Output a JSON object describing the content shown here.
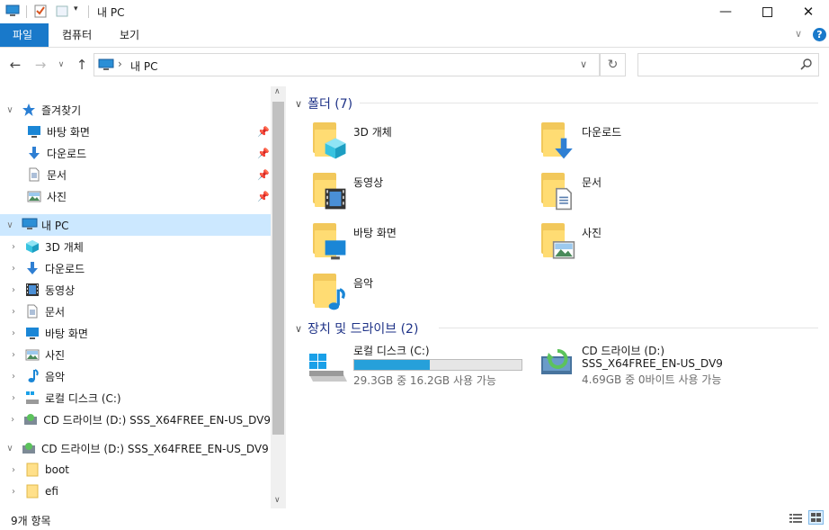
{
  "window": {
    "title": "내 PC"
  },
  "ribbon": {
    "tabs": [
      "파일",
      "컴퓨터",
      "보기"
    ]
  },
  "address": {
    "path": "내 PC",
    "separator": "›",
    "search_placeholder": ""
  },
  "nav": {
    "quick_access": {
      "label": "즐겨찾기",
      "items": [
        {
          "label": "바탕 화면",
          "icon": "desktop-icon"
        },
        {
          "label": "다운로드",
          "icon": "download-icon"
        },
        {
          "label": "문서",
          "icon": "documents-icon"
        },
        {
          "label": "사진",
          "icon": "pictures-icon"
        }
      ]
    },
    "this_pc": {
      "label": "내 PC",
      "items": [
        {
          "label": "3D 개체",
          "icon": "3d-objects-icon"
        },
        {
          "label": "다운로드",
          "icon": "download-icon"
        },
        {
          "label": "동영상",
          "icon": "videos-icon"
        },
        {
          "label": "문서",
          "icon": "documents-icon"
        },
        {
          "label": "바탕 화면",
          "icon": "desktop-icon"
        },
        {
          "label": "사진",
          "icon": "pictures-icon"
        },
        {
          "label": "음악",
          "icon": "music-icon"
        },
        {
          "label": "로컬 디스크 (C:)",
          "icon": "local-disk-icon"
        },
        {
          "label": "CD 드라이브 (D:) SSS_X64FREE_EN-US_DV9",
          "icon": "cd-drive-icon"
        }
      ]
    },
    "cd_drive": {
      "label": "CD 드라이브 (D:) SSS_X64FREE_EN-US_DV9",
      "items": [
        {
          "label": "boot",
          "icon": "folder-icon"
        },
        {
          "label": "efi",
          "icon": "folder-icon"
        }
      ]
    }
  },
  "content": {
    "folders_header": "폴더 (7)",
    "folders": [
      {
        "label": "3D 개체",
        "icon": "3d-objects-icon"
      },
      {
        "label": "다운로드",
        "icon": "download-icon"
      },
      {
        "label": "동영상",
        "icon": "videos-icon"
      },
      {
        "label": "문서",
        "icon": "documents-icon"
      },
      {
        "label": "바탕 화면",
        "icon": "desktop-icon"
      },
      {
        "label": "사진",
        "icon": "pictures-icon"
      },
      {
        "label": "음악",
        "icon": "music-icon"
      }
    ],
    "devices_header": "장치 및 드라이브 (2)",
    "drives": [
      {
        "label": "로컬 디스크 (C:)",
        "detail": "29.3GB 중 16.2GB 사용 가능",
        "used_fraction": 0.45,
        "icon": "local-disk-icon"
      },
      {
        "label": "CD 드라이브 (D:)",
        "sublabel": "SSS_X64FREE_EN-US_DV9",
        "detail": "4.69GB 중 0바이트 사용 가능",
        "icon": "cd-drive-icon"
      }
    ]
  },
  "status": {
    "item_count": "9개 항목"
  },
  "colors": {
    "accent": "#1979ca",
    "selection": "#cce8ff",
    "header_text": "#1e3287",
    "drive_fill": "#26a0da"
  }
}
